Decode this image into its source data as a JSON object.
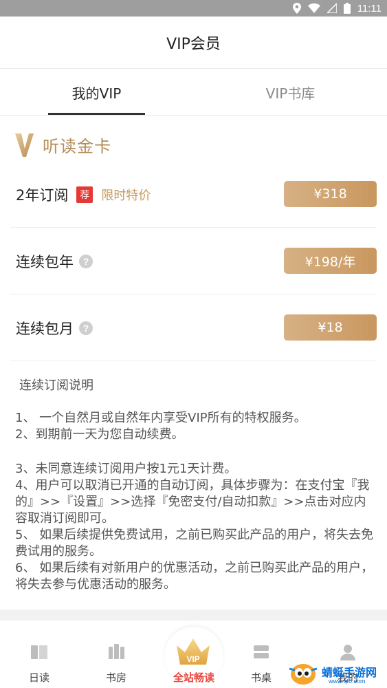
{
  "status_bar": {
    "time": "11:11"
  },
  "header": {
    "title": "VIP会员"
  },
  "tabs": [
    {
      "label": "我的VIP",
      "active": true
    },
    {
      "label": "VIP书库",
      "active": false
    }
  ],
  "section": {
    "mark": "V",
    "title": "听读金卡"
  },
  "plans": [
    {
      "label": "2年订阅",
      "badge": "荐",
      "promo": "限时特价",
      "price": "¥318"
    },
    {
      "label": "连续包年",
      "help": "?",
      "price": "¥198/年"
    },
    {
      "label": "连续包月",
      "help": "?",
      "price": "¥18"
    }
  ],
  "notes": {
    "title": "连续订阅说明",
    "items": [
      "1、 一个自然月或自然年内享受VIP所有的特权服务。",
      "2、到期前一天为您自动续费。",
      "3、未同意连续订阅用户按1元1天计费。",
      "4、用户可以取消已开通的自动订阅，具体步骤为：在支付宝『我的』>>『设置』>>选择『免密支付/自动扣款』>>点击对应内容取消订阅即可。",
      "5、 如果后续提供免费试用，之前已购买此产品的用户，将失去免费试用的服务。",
      "6、 如果后续有对新用户的优惠活动，之前已购买此产品的用户，将失去参与优惠活动的服务。"
    ]
  },
  "bottom_nav": {
    "items": [
      {
        "label": "日读",
        "icon": "book-open-icon"
      },
      {
        "label": "书房",
        "icon": "bookshelf-icon"
      },
      {
        "label": "全站畅读",
        "icon": "vip-crown-icon",
        "crown_text": "VIP"
      },
      {
        "label": "书桌",
        "icon": "desk-icon"
      },
      {
        "label": "我的",
        "icon": "user-icon"
      }
    ]
  },
  "watermark": {
    "text": "蜻蜓手游网",
    "sub": "www.qt6.com"
  },
  "colors": {
    "gold": "#b48b57",
    "button": "#cc9c66",
    "badge": "#e53935",
    "center_label": "#e8483e"
  }
}
